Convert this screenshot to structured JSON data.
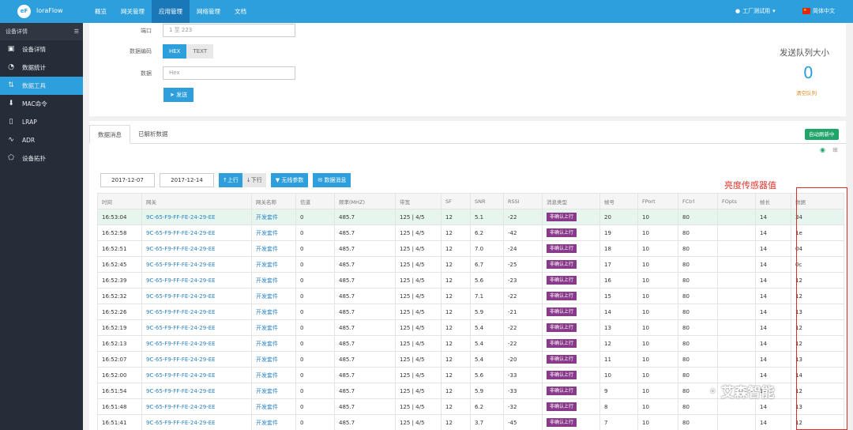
{
  "header": {
    "logo": "eF",
    "brand": "loraFlow",
    "nav": [
      "概览",
      "网关管理",
      "应用管理",
      "网络管理",
      "文档"
    ],
    "active_nav": 2,
    "user": "工厂测试用",
    "lang": "简体中文"
  },
  "sidebar": {
    "title": "设备详情",
    "items": [
      {
        "label": "设备详情",
        "icon": "card-icon"
      },
      {
        "label": "数据统计",
        "icon": "pie-chart-icon"
      },
      {
        "label": "数据工具",
        "icon": "sort-arrows-icon"
      },
      {
        "label": "MAC命令",
        "icon": "arrow-down-icon"
      },
      {
        "label": "LRAP",
        "icon": "cylinder-icon"
      },
      {
        "label": "ADR",
        "icon": "waveform-icon"
      },
      {
        "label": "设备拓扑",
        "icon": "pentagon-icon"
      }
    ],
    "active": 2
  },
  "send_form": {
    "port_label": "端口",
    "port_value": "1 至 223",
    "encoding_label": "数据编码",
    "encoding_options": [
      "HEX",
      "TEXT"
    ],
    "data_label": "数据",
    "data_placeholder": "Hex",
    "send_label": "发送",
    "queue_title": "发送队列大小",
    "queue_size": "0",
    "queue_clear": "清空队列"
  },
  "data_panel": {
    "tabs": [
      "数据消息",
      "已解析数据"
    ],
    "auto_refresh": "自动刷新中",
    "date_from": "2017-12-07",
    "date_to": "2017-12-14",
    "up_label": "上行",
    "down_label": "下行",
    "wireless_label": "无线参数",
    "msg_label": "数据消息"
  },
  "annotation": "亮度传感器值",
  "watermark": "艾森智能",
  "table": {
    "columns": [
      "时间",
      "网关",
      "网关名称",
      "信道",
      "频率(MHZ)",
      "带宽",
      "SF",
      "SNR",
      "RSSI",
      "消息类型",
      "帧号",
      "FPort",
      "FCtrl",
      "FOpts",
      "帧长",
      "数据"
    ],
    "rows": [
      [
        "16:53:04",
        "9C-65-F9-FF-FE-24-29-EE",
        "开发套件",
        "0",
        "485.7",
        "125 | 4/5",
        "12",
        "5.1",
        "-22",
        "非确认上行",
        "20",
        "10",
        "80",
        "",
        "14",
        "34"
      ],
      [
        "16:52:58",
        "9C-65-F9-FF-FE-24-29-EE",
        "开发套件",
        "0",
        "485.7",
        "125 | 4/5",
        "12",
        "6.2",
        "-42",
        "非确认上行",
        "19",
        "10",
        "80",
        "",
        "14",
        "1e"
      ],
      [
        "16:52:51",
        "9C-65-F9-FF-FE-24-29-EE",
        "开发套件",
        "0",
        "485.7",
        "125 | 4/5",
        "12",
        "7.0",
        "-24",
        "非确认上行",
        "18",
        "10",
        "80",
        "",
        "14",
        "04"
      ],
      [
        "16:52:45",
        "9C-65-F9-FF-FE-24-29-EE",
        "开发套件",
        "0",
        "485.7",
        "125 | 4/5",
        "12",
        "6.7",
        "-25",
        "非确认上行",
        "17",
        "10",
        "80",
        "",
        "14",
        "0c"
      ],
      [
        "16:52:39",
        "9C-65-F9-FF-FE-24-29-EE",
        "开发套件",
        "0",
        "485.7",
        "125 | 4/5",
        "12",
        "5.6",
        "-23",
        "非确认上行",
        "16",
        "10",
        "80",
        "",
        "14",
        "12"
      ],
      [
        "16:52:32",
        "9C-65-F9-FF-FE-24-29-EE",
        "开发套件",
        "0",
        "485.7",
        "125 | 4/5",
        "12",
        "7.1",
        "-22",
        "非确认上行",
        "15",
        "10",
        "80",
        "",
        "14",
        "12"
      ],
      [
        "16:52:26",
        "9C-65-F9-FF-FE-24-29-EE",
        "开发套件",
        "0",
        "485.7",
        "125 | 4/5",
        "12",
        "5.9",
        "-21",
        "非确认上行",
        "14",
        "10",
        "80",
        "",
        "14",
        "13"
      ],
      [
        "16:52:19",
        "9C-65-F9-FF-FE-24-29-EE",
        "开发套件",
        "0",
        "485.7",
        "125 | 4/5",
        "12",
        "5.4",
        "-22",
        "非确认上行",
        "13",
        "10",
        "80",
        "",
        "14",
        "12"
      ],
      [
        "16:52:13",
        "9C-65-F9-FF-FE-24-29-EE",
        "开发套件",
        "0",
        "485.7",
        "125 | 4/5",
        "12",
        "5.4",
        "-22",
        "非确认上行",
        "12",
        "10",
        "80",
        "",
        "14",
        "12"
      ],
      [
        "16:52:07",
        "9C-65-F9-FF-FE-24-29-EE",
        "开发套件",
        "0",
        "485.7",
        "125 | 4/5",
        "12",
        "5.4",
        "-20",
        "非确认上行",
        "11",
        "10",
        "80",
        "",
        "14",
        "13"
      ],
      [
        "16:52:00",
        "9C-65-F9-FF-FE-24-29-EE",
        "开发套件",
        "0",
        "485.7",
        "125 | 4/5",
        "12",
        "5.6",
        "-33",
        "非确认上行",
        "10",
        "10",
        "80",
        "",
        "14",
        "14"
      ],
      [
        "16:51:54",
        "9C-65-F9-FF-FE-24-29-EE",
        "开发套件",
        "0",
        "485.7",
        "125 | 4/5",
        "12",
        "5.9",
        "-33",
        "非确认上行",
        "9",
        "10",
        "80",
        "",
        "14",
        "12"
      ],
      [
        "16:51:48",
        "9C-65-F9-FF-FE-24-29-EE",
        "开发套件",
        "0",
        "485.7",
        "125 | 4/5",
        "12",
        "6.2",
        "-32",
        "非确认上行",
        "8",
        "10",
        "80",
        "",
        "14",
        "13"
      ],
      [
        "16:51:41",
        "9C-65-F9-FF-FE-24-29-EE",
        "开发套件",
        "0",
        "485.7",
        "125 | 4/5",
        "12",
        "3.7",
        "-45",
        "非确认上行",
        "7",
        "10",
        "80",
        "",
        "14",
        "12"
      ]
    ]
  }
}
